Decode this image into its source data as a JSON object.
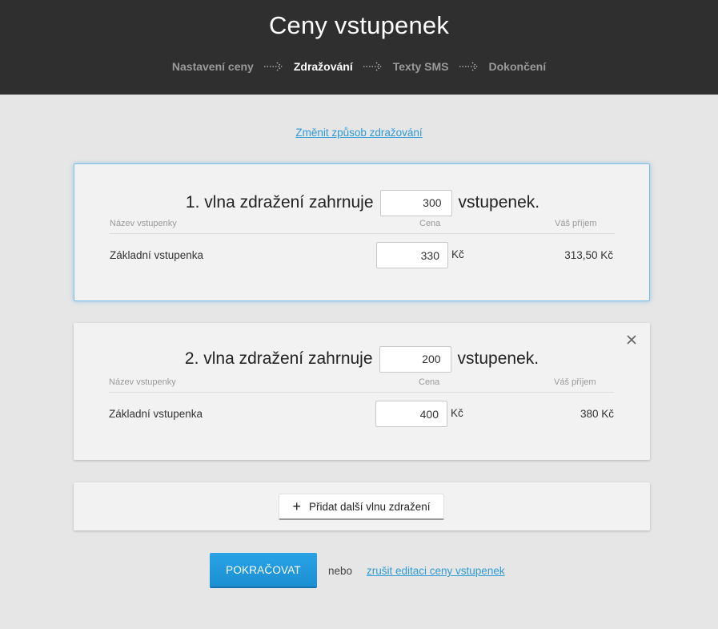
{
  "header": {
    "title": "Ceny vstupenek",
    "steps": [
      {
        "label": "Nastavení ceny",
        "active": false
      },
      {
        "label": "Zdražování",
        "active": true
      },
      {
        "label": "Texty SMS",
        "active": false
      },
      {
        "label": "Dokončení",
        "active": false
      }
    ]
  },
  "change_link": "Změnit způsob zdražování",
  "table_headers": {
    "name": "Název vstupenky",
    "price": "Cena",
    "income": "Váš příjem"
  },
  "waves": [
    {
      "prefix": "1. vlna zdražení zahrnuje",
      "count": "300",
      "suffix": "vstupenek.",
      "ticket_name": "Základní vstupenka",
      "price": "330",
      "currency": "Kč",
      "income": "313,50 Kč"
    },
    {
      "prefix": "2. vlna zdražení zahrnuje",
      "count": "200",
      "suffix": "vstupenek.",
      "ticket_name": "Základní vstupenka",
      "price": "400",
      "currency": "Kč",
      "income": "380 Kč"
    }
  ],
  "add_wave_label": "Přidat další vlnu zdražení",
  "footer": {
    "continue_label": "POKRAČOVAT",
    "or_text": "nebo",
    "cancel_label": "zrušit editaci ceny vstupenek"
  },
  "colors": {
    "header_bg": "#2f2f2f",
    "accent": "#2e9bd6",
    "page_bg": "#e6e6e6"
  }
}
